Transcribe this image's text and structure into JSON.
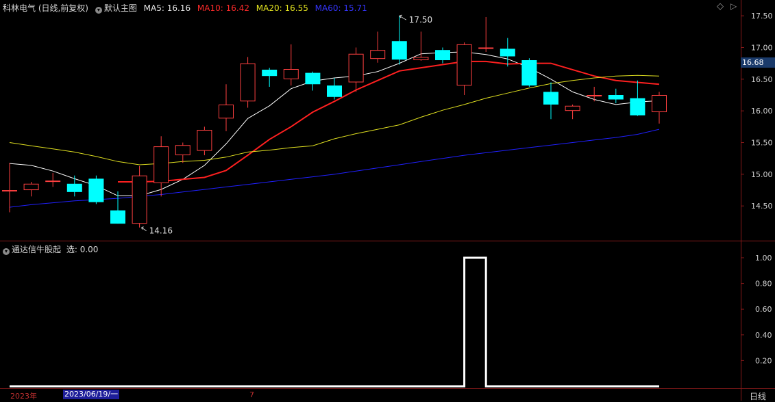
{
  "header": {
    "stock_label": "科林电气 (日线,前复权)",
    "main_chart_label": "默认主图",
    "ma5": "MA5: 16.16",
    "ma10": "MA10: 16.42",
    "ma20": "MA20: 16.55",
    "ma60": "MA60: 15.71"
  },
  "indicator": {
    "label": "通达信牛股起",
    "value_text": "选: 0.00"
  },
  "bottom": {
    "year": "2023年",
    "date_cursor": "2023/06/19/一",
    "month": "7",
    "period": "日线"
  },
  "price_tag": "16.68",
  "high_annotation": "17.50",
  "low_annotation": "14.16",
  "colors": {
    "up": "#ff4040",
    "down": "#00ffff",
    "ma5": "#ffffff",
    "ma10": "#ff2020",
    "ma20": "#e0e020",
    "ma60": "#2020ff",
    "frame": "#8a1a1a",
    "indicator_line": "#ffffff"
  },
  "chart_data": [
    {
      "type": "candlestick",
      "title": "科林电气 (日线,前复权)",
      "ylim": [
        14.2,
        17.62
      ],
      "y_ticks": [
        "17.50",
        "17.00",
        "16.50",
        "16.00",
        "15.50",
        "15.00",
        "14.50"
      ],
      "y_tick_values": [
        17.5,
        17.0,
        16.5,
        16.0,
        15.5,
        15.0,
        14.5
      ],
      "candles": [
        {
          "o": 14.75,
          "h": 15.18,
          "l": 14.4,
          "c": 14.75
        },
        {
          "o": 14.75,
          "h": 14.88,
          "l": 14.65,
          "c": 14.85
        },
        {
          "o": 14.9,
          "h": 15.02,
          "l": 14.8,
          "c": 14.9
        },
        {
          "o": 14.85,
          "h": 14.98,
          "l": 14.65,
          "c": 14.72
        },
        {
          "o": 14.93,
          "h": 14.98,
          "l": 14.53,
          "c": 14.56
        },
        {
          "o": 14.43,
          "h": 14.73,
          "l": 14.22,
          "c": 14.22
        },
        {
          "o": 14.22,
          "h": 15.13,
          "l": 14.16,
          "c": 14.98
        },
        {
          "o": 14.86,
          "h": 15.6,
          "l": 14.65,
          "c": 15.44
        },
        {
          "o": 15.3,
          "h": 15.5,
          "l": 15.18,
          "c": 15.46
        },
        {
          "o": 15.37,
          "h": 15.75,
          "l": 15.3,
          "c": 15.7
        },
        {
          "o": 15.88,
          "h": 16.42,
          "l": 15.68,
          "c": 16.1
        },
        {
          "o": 16.15,
          "h": 16.85,
          "l": 16.05,
          "c": 16.75
        },
        {
          "o": 16.65,
          "h": 16.68,
          "l": 16.38,
          "c": 16.55
        },
        {
          "o": 16.5,
          "h": 17.05,
          "l": 16.4,
          "c": 16.66
        },
        {
          "o": 16.6,
          "h": 16.62,
          "l": 16.32,
          "c": 16.42
        },
        {
          "o": 16.4,
          "h": 16.52,
          "l": 16.18,
          "c": 16.22
        },
        {
          "o": 16.45,
          "h": 17.0,
          "l": 16.3,
          "c": 16.9
        },
        {
          "o": 16.82,
          "h": 17.25,
          "l": 16.76,
          "c": 16.96
        },
        {
          "o": 17.1,
          "h": 17.5,
          "l": 16.73,
          "c": 16.81
        },
        {
          "o": 16.8,
          "h": 17.25,
          "l": 16.79,
          "c": 16.85
        },
        {
          "o": 16.96,
          "h": 17.0,
          "l": 16.75,
          "c": 16.8
        },
        {
          "o": 16.4,
          "h": 17.08,
          "l": 16.25,
          "c": 17.05
        },
        {
          "o": 16.98,
          "h": 17.48,
          "l": 16.93,
          "c": 17.0
        },
        {
          "o": 16.98,
          "h": 17.15,
          "l": 16.7,
          "c": 16.86
        },
        {
          "o": 16.8,
          "h": 16.83,
          "l": 16.38,
          "c": 16.4
        },
        {
          "o": 16.3,
          "h": 16.45,
          "l": 15.87,
          "c": 16.1
        },
        {
          "o": 16.0,
          "h": 16.1,
          "l": 15.87,
          "c": 16.08
        },
        {
          "o": 16.23,
          "h": 16.38,
          "l": 16.15,
          "c": 16.25
        },
        {
          "o": 16.25,
          "h": 16.35,
          "l": 16.12,
          "c": 16.18
        },
        {
          "o": 16.2,
          "h": 16.48,
          "l": 15.92,
          "c": 15.93
        },
        {
          "o": 15.98,
          "h": 16.3,
          "l": 15.8,
          "c": 16.25
        }
      ],
      "series": [
        {
          "name": "MA5",
          "values": [
            15.17,
            15.14,
            15.05,
            14.93,
            14.82,
            14.66,
            14.66,
            14.76,
            14.92,
            15.14,
            15.48,
            15.88,
            16.08,
            16.35,
            16.47,
            16.52,
            16.55,
            16.62,
            16.75,
            16.9,
            16.92,
            16.93,
            16.89,
            16.82,
            16.68,
            16.5,
            16.3,
            16.18,
            16.1,
            16.14,
            16.16
          ]
        },
        {
          "name": "MA10",
          "values": [
            null,
            null,
            null,
            null,
            null,
            14.88,
            14.88,
            14.89,
            14.92,
            14.95,
            15.06,
            15.3,
            15.55,
            15.75,
            15.98,
            16.15,
            16.33,
            16.48,
            16.63,
            16.68,
            16.73,
            16.78,
            16.78,
            16.74,
            16.75,
            16.75,
            16.65,
            16.55,
            16.48,
            16.45,
            16.42
          ]
        },
        {
          "name": "MA20",
          "values": [
            15.5,
            15.45,
            15.4,
            15.35,
            15.28,
            15.2,
            15.15,
            15.17,
            15.2,
            15.22,
            15.27,
            15.35,
            15.38,
            15.42,
            15.45,
            15.56,
            15.64,
            15.71,
            15.78,
            15.9,
            16.01,
            16.1,
            16.2,
            16.28,
            16.36,
            16.43,
            16.48,
            16.52,
            16.55,
            16.56,
            16.55
          ]
        },
        {
          "name": "MA60",
          "values": [
            14.48,
            14.52,
            14.55,
            14.58,
            14.6,
            14.62,
            14.65,
            14.68,
            14.72,
            14.76,
            14.8,
            14.84,
            14.88,
            14.92,
            14.96,
            15.0,
            15.05,
            15.1,
            15.15,
            15.2,
            15.25,
            15.3,
            15.34,
            15.38,
            15.42,
            15.46,
            15.5,
            15.54,
            15.58,
            15.63,
            15.71
          ]
        }
      ]
    },
    {
      "type": "line",
      "title": "通达信牛股起",
      "ylim": [
        0,
        1.1
      ],
      "y_ticks": [
        "1.00",
        "0.80",
        "0.60",
        "0.40",
        "0.20"
      ],
      "y_tick_values": [
        1.0,
        0.8,
        0.6,
        0.4,
        0.2
      ],
      "series": [
        {
          "name": "选",
          "values": [
            0,
            0,
            0,
            0,
            0,
            0,
            0,
            0,
            0,
            0,
            0,
            0,
            0,
            0,
            0,
            0,
            0,
            0,
            0,
            0,
            0,
            1,
            0,
            0,
            0,
            0,
            0,
            0,
            0,
            0,
            0
          ]
        }
      ]
    }
  ]
}
